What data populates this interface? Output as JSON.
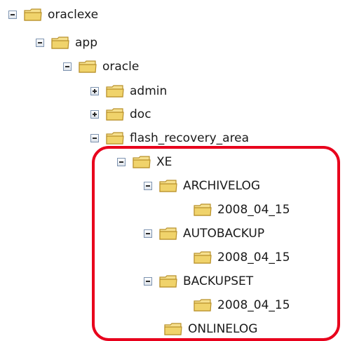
{
  "tree": {
    "nodes": [
      {
        "label": "oraclexe",
        "expander": "minus",
        "level": 0
      },
      {
        "label": "app",
        "expander": "minus",
        "level": 1
      },
      {
        "label": "oracle",
        "expander": "minus",
        "level": 2
      },
      {
        "label": "admin",
        "expander": "plus",
        "level": 3
      },
      {
        "label": "doc",
        "expander": "plus",
        "level": 3
      },
      {
        "label": "flash_recovery_area",
        "expander": "minus",
        "level": 3
      },
      {
        "label": "XE",
        "expander": "minus",
        "level": 4
      },
      {
        "label": "ARCHIVELOG",
        "expander": "minus",
        "level": 5
      },
      {
        "label": "2008_04_15",
        "expander": "none",
        "level": 6
      },
      {
        "label": "AUTOBACKUP",
        "expander": "minus",
        "level": 5
      },
      {
        "label": "2008_04_15",
        "expander": "none",
        "level": 6
      },
      {
        "label": "BACKUPSET",
        "expander": "minus",
        "level": 5
      },
      {
        "label": "2008_04_15",
        "expander": "none",
        "level": 6
      },
      {
        "label": "ONLINELOG",
        "expander": "none",
        "level": 5
      }
    ]
  },
  "icons": {
    "folder": "folder-icon",
    "expand": "plus-expander-icon",
    "collapse": "minus-expander-icon"
  },
  "colors": {
    "highlight": "#e8001c",
    "folder_body": "#f0d36b",
    "folder_border": "#b8902a"
  }
}
